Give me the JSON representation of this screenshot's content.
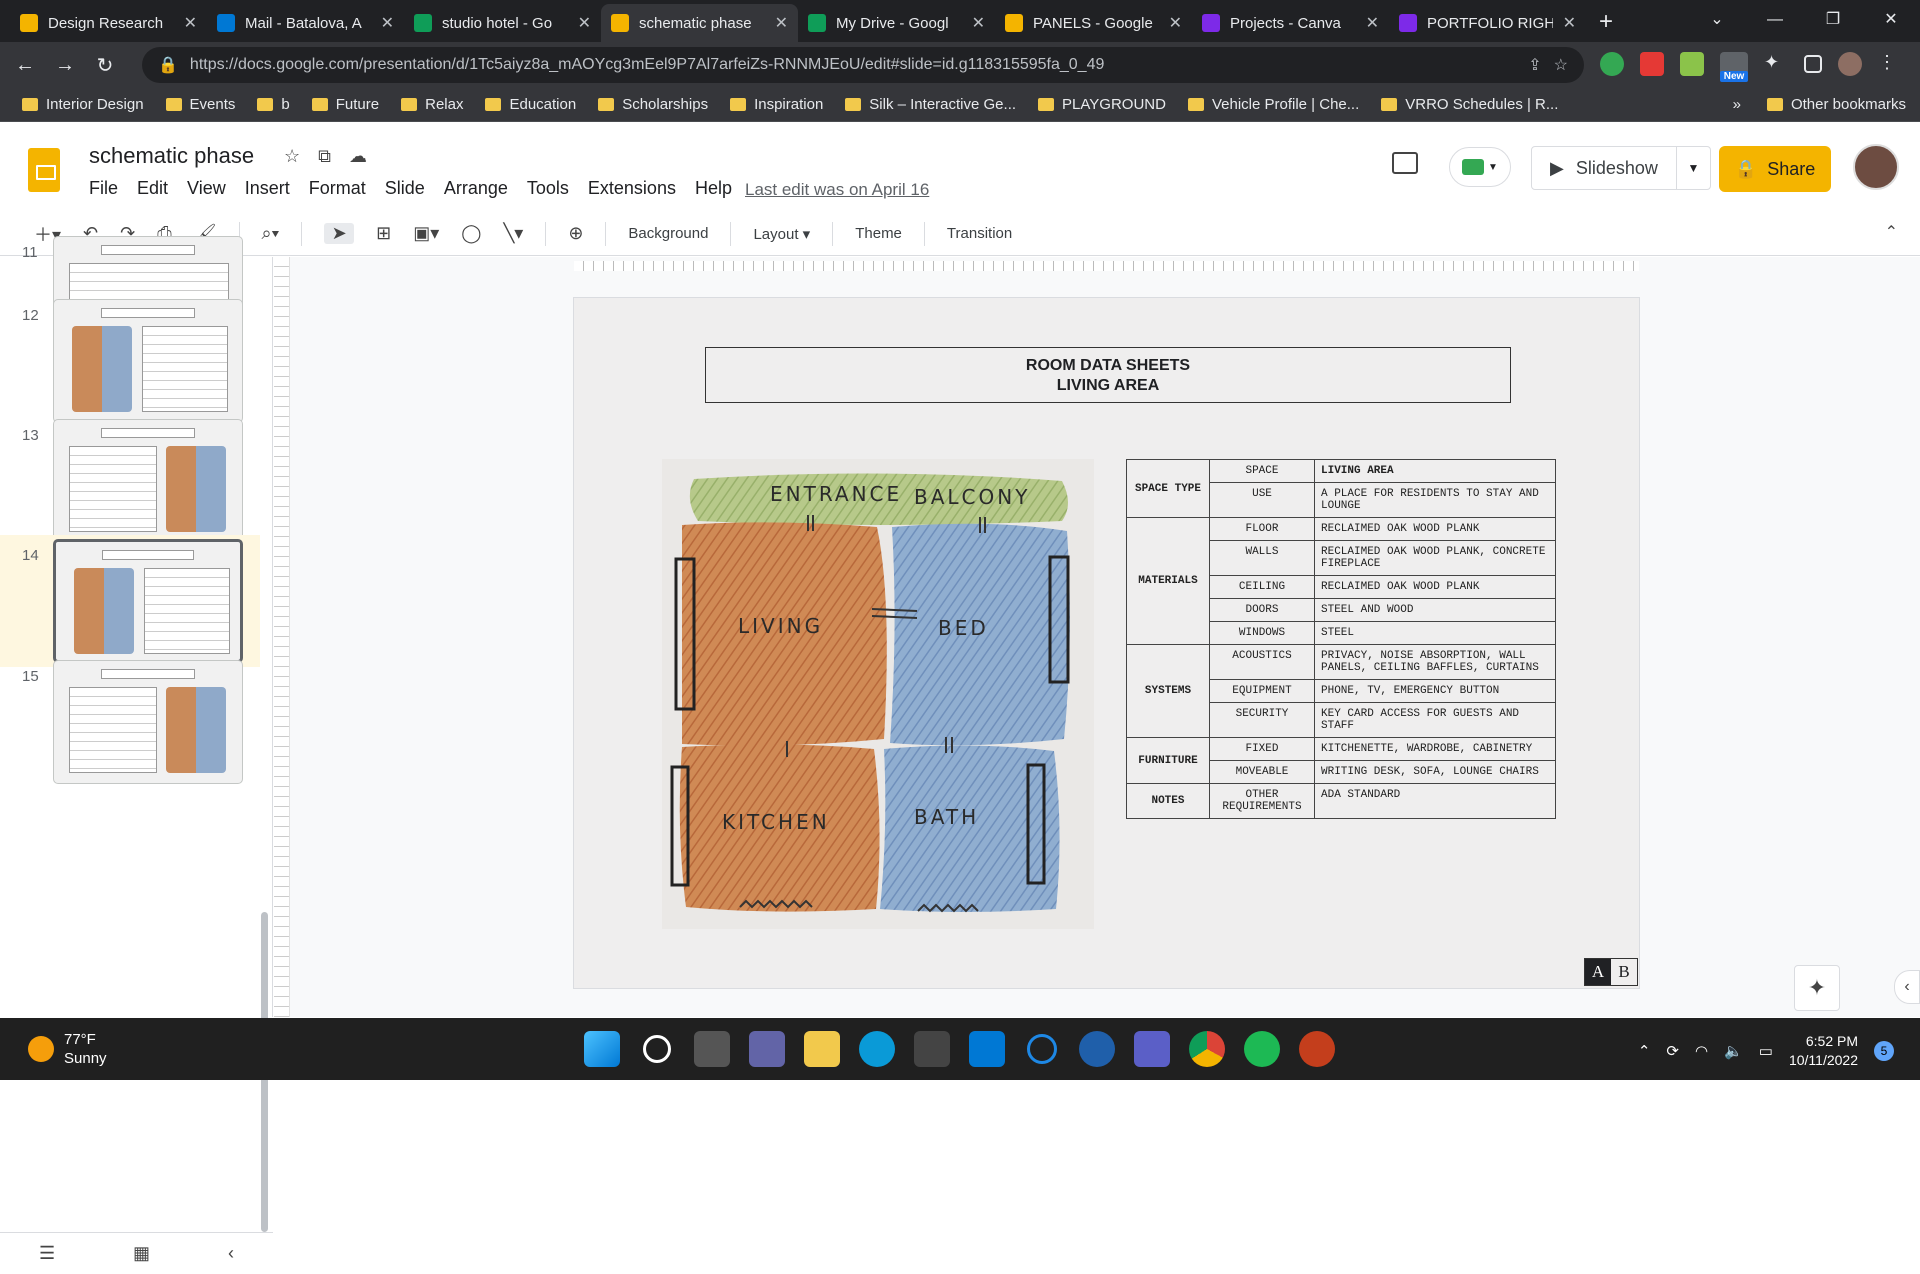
{
  "browser": {
    "tabs": [
      {
        "title": "Design Research",
        "color": "#f4b400"
      },
      {
        "title": "Mail - Batalova, A",
        "color": "#0078d4"
      },
      {
        "title": "studio hotel - Go",
        "color": "#0f9d58"
      },
      {
        "title": "schematic phase",
        "color": "#f4b400",
        "active": true
      },
      {
        "title": "My Drive - Googl",
        "color": "#0f9d58"
      },
      {
        "title": "PANELS - Google",
        "color": "#f4b400"
      },
      {
        "title": "Projects - Canva",
        "color": "#7d2ae8"
      },
      {
        "title": "PORTFOLIO RIGH",
        "color": "#7d2ae8"
      }
    ],
    "url": "https://docs.google.com/presentation/d/1Tc5aiyz8a_mAOYcg3mEel9P7Al7arfeiZs-RNNMJEoU/edit#slide=id.g118315595fa_0_49",
    "ext_new_badge": "New",
    "bookmarks": [
      "Interior Design",
      "Events",
      "b",
      "Future",
      "Relax",
      "Education",
      "Scholarships",
      "Inspiration",
      "Silk – Interactive Ge...",
      "PLAYGROUND",
      "Vehicle Profile | Che...",
      "VRRO Schedules | R..."
    ],
    "other_bookmarks": "Other bookmarks"
  },
  "doc": {
    "title": "schematic phase",
    "menus": [
      "File",
      "Edit",
      "View",
      "Insert",
      "Format",
      "Slide",
      "Arrange",
      "Tools",
      "Extensions",
      "Help"
    ],
    "last_edit": "Last edit was on April 16",
    "slideshow_label": "Slideshow",
    "share_label": "Share"
  },
  "toolbar": {
    "background": "Background",
    "layout": "Layout",
    "theme": "Theme",
    "transition": "Transition"
  },
  "filmstrip": {
    "slides": [
      {
        "num": "11",
        "layout": "table"
      },
      {
        "num": "12",
        "layout": "image-left"
      },
      {
        "num": "13",
        "layout": "image-right"
      },
      {
        "num": "14",
        "layout": "image-left",
        "active": true
      },
      {
        "num": "15",
        "layout": "image-right"
      }
    ]
  },
  "slide": {
    "title_line1": "ROOM DATA SHEETS",
    "title_line2": "LIVING AREA",
    "sketch_labels": {
      "entrance": "ENTRANCE",
      "balcony": "BALCONY",
      "living": "LIVING",
      "bed": "BED",
      "kitchen": "KITCHEN",
      "bath": "BATH"
    },
    "table": [
      {
        "cat": "SPACE TYPE",
        "rows": [
          [
            "SPACE",
            "LIVING AREA"
          ],
          [
            "USE",
            "A PLACE FOR RESIDENTS TO STAY AND LOUNGE"
          ]
        ]
      },
      {
        "cat": "MATERIALS",
        "rows": [
          [
            "FLOOR",
            "RECLAIMED OAK WOOD PLANK"
          ],
          [
            "WALLS",
            "RECLAIMED OAK WOOD PLANK, CONCRETE FIREPLACE"
          ],
          [
            "CEILING",
            "RECLAIMED OAK WOOD PLANK"
          ],
          [
            "DOORS",
            "STEEL AND WOOD"
          ],
          [
            "WINDOWS",
            "STEEL"
          ]
        ]
      },
      {
        "cat": "SYSTEMS",
        "rows": [
          [
            "ACOUSTICS",
            "PRIVACY, NOISE ABSORPTION, WALL PANELS, CEILING BAFFLES, CURTAINS"
          ],
          [
            "EQUIPMENT",
            "PHONE, TV, EMERGENCY BUTTON"
          ],
          [
            "SECURITY",
            "KEY CARD ACCESS FOR GUESTS AND STAFF"
          ]
        ]
      },
      {
        "cat": "FURNITURE",
        "rows": [
          [
            "FIXED",
            "KITCHENETTE, WARDROBE, CABINETRY"
          ],
          [
            "MOVEABLE",
            "WRITING DESK, SOFA, LOUNGE CHAIRS"
          ]
        ]
      },
      {
        "cat": "NOTES",
        "rows": [
          [
            "OTHER REQUIREMENTS",
            "ADA STANDARD"
          ]
        ]
      }
    ],
    "badge_a": "A",
    "badge_b": "B"
  },
  "taskbar": {
    "temp": "77°F",
    "condition": "Sunny",
    "time": "6:52 PM",
    "date": "10/11/2022",
    "notifications": "5"
  }
}
